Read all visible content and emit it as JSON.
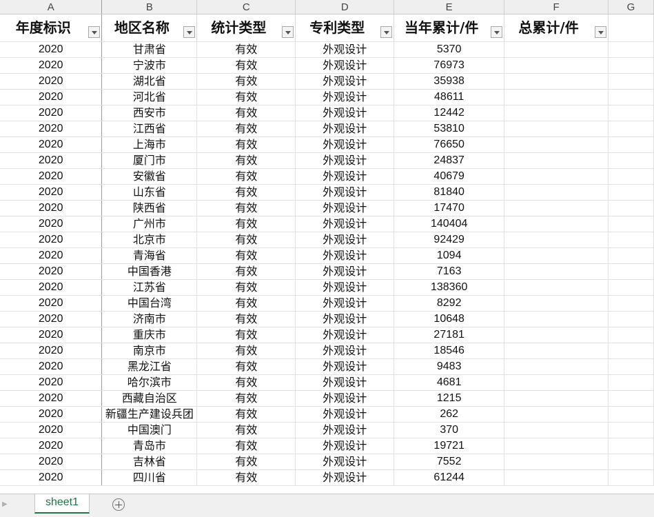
{
  "columns": [
    "A",
    "B",
    "C",
    "D",
    "E",
    "F",
    "G"
  ],
  "headers": [
    "年度标识",
    "地区名称",
    "统计类型",
    "专利类型",
    "当年累计/件",
    "总累计/件"
  ],
  "rows": [
    [
      "2020",
      "甘肃省",
      "有效",
      "外观设计",
      "5370",
      ""
    ],
    [
      "2020",
      "宁波市",
      "有效",
      "外观设计",
      "76973",
      ""
    ],
    [
      "2020",
      "湖北省",
      "有效",
      "外观设计",
      "35938",
      ""
    ],
    [
      "2020",
      "河北省",
      "有效",
      "外观设计",
      "48611",
      ""
    ],
    [
      "2020",
      "西安市",
      "有效",
      "外观设计",
      "12442",
      ""
    ],
    [
      "2020",
      "江西省",
      "有效",
      "外观设计",
      "53810",
      ""
    ],
    [
      "2020",
      "上海市",
      "有效",
      "外观设计",
      "76650",
      ""
    ],
    [
      "2020",
      "厦门市",
      "有效",
      "外观设计",
      "24837",
      ""
    ],
    [
      "2020",
      "安徽省",
      "有效",
      "外观设计",
      "40679",
      ""
    ],
    [
      "2020",
      "山东省",
      "有效",
      "外观设计",
      "81840",
      ""
    ],
    [
      "2020",
      "陕西省",
      "有效",
      "外观设计",
      "17470",
      ""
    ],
    [
      "2020",
      "广州市",
      "有效",
      "外观设计",
      "140404",
      ""
    ],
    [
      "2020",
      "北京市",
      "有效",
      "外观设计",
      "92429",
      ""
    ],
    [
      "2020",
      "青海省",
      "有效",
      "外观设计",
      "1094",
      ""
    ],
    [
      "2020",
      "中国香港",
      "有效",
      "外观设计",
      "7163",
      ""
    ],
    [
      "2020",
      "江苏省",
      "有效",
      "外观设计",
      "138360",
      ""
    ],
    [
      "2020",
      "中国台湾",
      "有效",
      "外观设计",
      "8292",
      ""
    ],
    [
      "2020",
      "济南市",
      "有效",
      "外观设计",
      "10648",
      ""
    ],
    [
      "2020",
      "重庆市",
      "有效",
      "外观设计",
      "27181",
      ""
    ],
    [
      "2020",
      "南京市",
      "有效",
      "外观设计",
      "18546",
      ""
    ],
    [
      "2020",
      "黑龙江省",
      "有效",
      "外观设计",
      "9483",
      ""
    ],
    [
      "2020",
      "哈尔滨市",
      "有效",
      "外观设计",
      "4681",
      ""
    ],
    [
      "2020",
      "西藏自治区",
      "有效",
      "外观设计",
      "1215",
      ""
    ],
    [
      "2020",
      "新疆生产建设兵团",
      "有效",
      "外观设计",
      "262",
      ""
    ],
    [
      "2020",
      "中国澳门",
      "有效",
      "外观设计",
      "370",
      ""
    ],
    [
      "2020",
      "青岛市",
      "有效",
      "外观设计",
      "19721",
      ""
    ],
    [
      "2020",
      "吉林省",
      "有效",
      "外观设计",
      "7552",
      ""
    ],
    [
      "2020",
      "四川省",
      "有效",
      "外观设计",
      "61244",
      ""
    ]
  ],
  "sheet_tabs": [
    "sheet1"
  ],
  "active_tab": "sheet1",
  "icons": {
    "filter": "filter-dropdown-icon",
    "add_sheet": "add-sheet-icon",
    "scroll_left": "scroll-left-icon"
  },
  "colors": {
    "accent": "#217346",
    "header_bg": "#efefef"
  }
}
